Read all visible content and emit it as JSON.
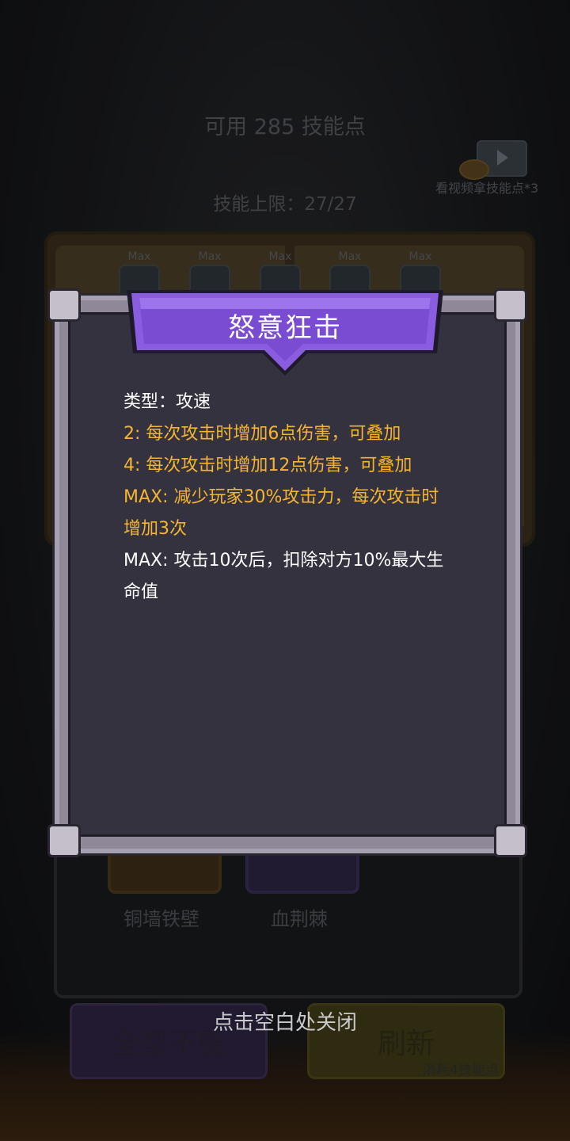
{
  "header": {
    "available_points": "可用 285 技能点",
    "skill_limit": "技能上限：27/27",
    "video_reward": "看视频拿技能点*3"
  },
  "book": {
    "slots": [
      "Max",
      "Max",
      "Max",
      "Max",
      "Max"
    ]
  },
  "cards": [
    {
      "name": "铜墙铁壁"
    },
    {
      "name": "血荆棘"
    }
  ],
  "buttons": {
    "reject_all": "全都不要",
    "refresh": "刷新",
    "refresh_cost": "消耗4技能点"
  },
  "dialog": {
    "title": "怒意狂击",
    "type_line": "类型：攻速",
    "level2": "2: 每次攻击时增加6点伤害，可叠加",
    "level4": "4: 每次攻击时增加12点伤害，可叠加",
    "max1": "MAX: 减少玩家30%攻击力，每次攻击时增加3次",
    "max2": "MAX: 攻击10次后，扣除对方10%最大生命值"
  },
  "close_hint": "点击空白处关闭",
  "colors": {
    "highlight_text": "#f5b531",
    "title_banner": "#8a5ce0",
    "dialog_bg": "#34323f"
  }
}
